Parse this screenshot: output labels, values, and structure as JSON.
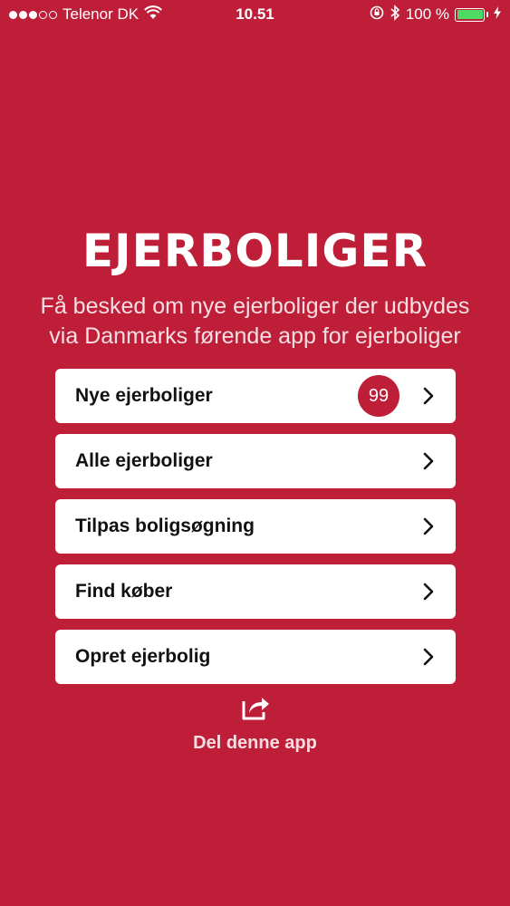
{
  "status_bar": {
    "carrier": "Telenor DK",
    "time": "10.51",
    "battery": "100 %",
    "signal_bars_full": 3,
    "signal_bars_total": 5
  },
  "app": {
    "title": "EJERBOLIGER",
    "subtitle_line1": "Få besked om nye ejerboliger der udbydes",
    "subtitle_line2": "via Danmarks førende app for ejerboliger"
  },
  "menu": {
    "items": [
      {
        "label": "Nye ejerboliger",
        "badge": "99"
      },
      {
        "label": "Alle ejerboliger"
      },
      {
        "label": "Tilpas boligsøgning"
      },
      {
        "label": "Find køber"
      },
      {
        "label": "Opret ejerbolig"
      }
    ]
  },
  "share": {
    "label": "Del denne app",
    "icon": "share-icon"
  },
  "colors": {
    "background": "#BE1E38",
    "battery": "#4CD964",
    "card": "#FFFFFF"
  }
}
